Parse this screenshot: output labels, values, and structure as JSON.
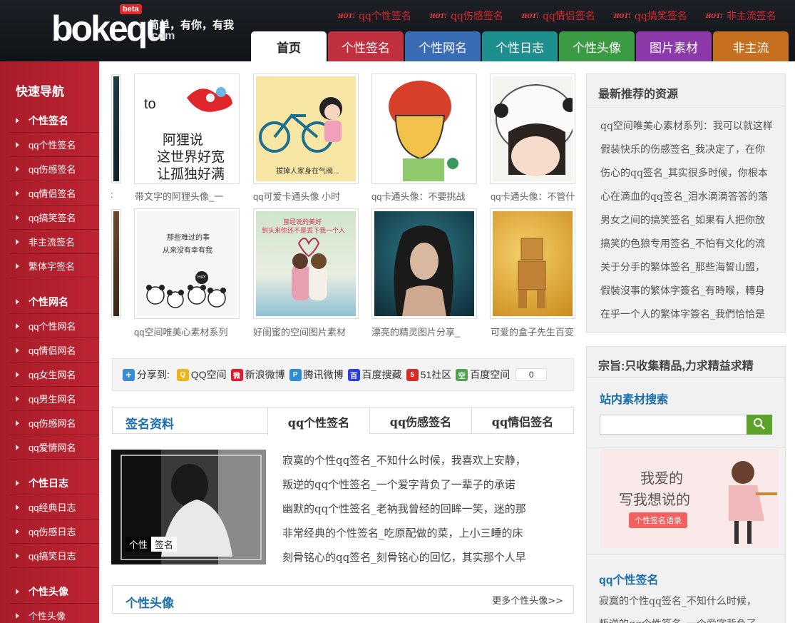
{
  "header": {
    "logo_text": "bokequ",
    "logo_beta": "beta",
    "logo_com": ".com",
    "slogan": "简单，有你，有我",
    "hot_badge": "HOT!",
    "hot_links": [
      "qq个性签名",
      "qq伤感签名",
      "qq情侣签名",
      "qq搞笑签名",
      "非主流签名"
    ]
  },
  "nav": {
    "tabs": [
      {
        "label": "首页",
        "color": "#ffffff"
      },
      {
        "label": "个性签名",
        "color": "#c0303e"
      },
      {
        "label": "个性网名",
        "color": "#3a6cb4"
      },
      {
        "label": "个性日志",
        "color": "#1d8f8e"
      },
      {
        "label": "个性头像",
        "color": "#3b9a43"
      },
      {
        "label": "图片素材",
        "color": "#8b3aa8"
      },
      {
        "label": "非主流",
        "color": "#c4701f"
      }
    ]
  },
  "sidebar": {
    "title": "快速导航",
    "groups": [
      {
        "head": "个性签名",
        "items": [
          "qq个性签名",
          "qq伤感签名",
          "qq情侣签名",
          "qq搞笑签名",
          "非主流签名",
          "繁体字签名"
        ]
      },
      {
        "head": "个性网名",
        "items": [
          "qq个性网名",
          "qq情侣网名",
          "qq女生网名",
          "qq男生网名",
          "qq伤感网名",
          "qq爱情网名"
        ]
      },
      {
        "head": "个性日志",
        "items": [
          "qq经典日志",
          "qq伤感日志",
          "qq搞笑日志"
        ]
      },
      {
        "head": "个性头像",
        "items": [
          "个性头像"
        ]
      }
    ]
  },
  "gallery": {
    "row1_captions": [
      "带文字的阿狸头像_一",
      "qq可爱卡通头像 小时",
      "qq卡通头像：不要挑战",
      "qq卡通头像：不管什"
    ],
    "row2_captions": [
      "qq空间唯美心素材系列",
      "好闺蜜的空间图片素材",
      "漂亮的精灵图片分享_",
      "可爱的盒子先生百变"
    ],
    "img1_text": [
      "to",
      "阿狸说",
      "这世界好宽",
      "让孤独好满"
    ],
    "img2_text": "拔掉人家身在气阀...",
    "img5_text": [
      "那些难过的事",
      "从来没有幸有我"
    ],
    "img5_badge": "HAY",
    "img6_text": [
      "曾经说的美好",
      "到头来你还不是丢下我一个人"
    ]
  },
  "share": {
    "label": "分享到:",
    "items": [
      {
        "label": "QQ空间",
        "color": "#f2b318",
        "glyph": "Q"
      },
      {
        "label": "新浪微博",
        "color": "#e6162d",
        "glyph": "微"
      },
      {
        "label": "腾讯微博",
        "color": "#2b8bd6",
        "glyph": "P"
      },
      {
        "label": "百度搜藏",
        "color": "#2d3be0",
        "glyph": "百"
      },
      {
        "label": "51社区",
        "color": "#d62a2a",
        "glyph": "5"
      },
      {
        "label": "百度空间",
        "color": "#4aa34a",
        "glyph": "空"
      }
    ],
    "count": "0"
  },
  "signature": {
    "title": "签名资料",
    "tabs": [
      "qq个性签名",
      "qq伤感签名",
      "qq情侣签名"
    ],
    "feature_tags": [
      "个性",
      "签名"
    ],
    "lines": [
      "寂寞的个性qq签名_不知什么时候，我喜欢上安静，",
      "叛逆的qq个性签名_一个爱字背负了一辈子的承诺",
      "幽默的qq个性签名_老衲我曾经的回眸一笑，迷的那",
      "非常经典的个性签名_吃原配做的菜，上小三睡的床",
      "刻骨铭心的qq签名_刻骨铭心的回忆，其实那个人早"
    ]
  },
  "avatar_section": {
    "title": "个性头像",
    "more": "更多个性头像>>"
  },
  "right": {
    "recommend_title": "最新推荐的资源",
    "recommend": [
      "qq空间唯美心素材系列：我可以就这样",
      "假装快乐的伤感签名_我决定了，在你",
      "伤心的qq签名_其实很多时候，你根本",
      "心在滴血的qq签名_泪水滴滴答答的落",
      "男女之间的搞笑签名_如果有人把你放",
      "搞笑的色狼专用签名_不怕有文化的流",
      "关于分手的繁体签名_那些海誓山盟，",
      "假裝沒事的繁体字簽名_有時喉，轉身",
      "在乎一个人的繁体字簽名_我們恰恰是"
    ],
    "motto_title": "宗旨:只收集精品,力求精益求精",
    "search_title": "站内素材搜索",
    "search_placeholder": "",
    "banner_text": [
      "我爱的",
      "写我想说的"
    ],
    "banner_btn": "个性签名语录",
    "qq_title": "qq个性签名",
    "qq_lines": [
      "寂寞的个性qq签名_不知什么时候，",
      "叛逆的qq个性签名_一个爱字背负了"
    ]
  }
}
